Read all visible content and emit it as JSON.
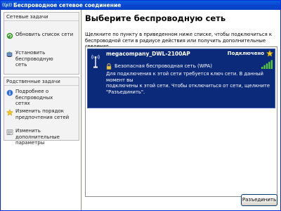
{
  "window": {
    "title": "Беспроводное сетевое соединение",
    "icon_text": "((p))"
  },
  "left_pane": {
    "network_tasks": {
      "title": "Сетевые задачи",
      "items": [
        {
          "label": "Обновить список сети",
          "icon": "refresh-icon"
        },
        {
          "label": "Установить беспроводную\nсеть",
          "icon": "setup-network-icon"
        }
      ]
    },
    "related_tasks": {
      "title": "Родственные задачи",
      "items": [
        {
          "label": "Подробнее о беспроводных\nсетях",
          "icon": "info-icon"
        },
        {
          "label": "Изменить порядок\nпредпочтения сетей",
          "icon": "star-order-icon"
        },
        {
          "label": "Изменить дополнительные\nпараметры",
          "icon": "settings-icon"
        }
      ]
    }
  },
  "main": {
    "title": "Выберите беспроводную сеть",
    "description": "Щелкните по пункту в приведенном ниже списке, чтобы подключиться к\nбеспроводной сети в радиусе действия или получить дополнительные сведения.",
    "networks": [
      {
        "ssid": "megacompany_DWL-2100AP",
        "status": "Подключено",
        "security": "Безопасная беспроводная сеть (WPA)",
        "info": "Для подключения к этой сети требуется ключ сети. В данный момент вы\nподключены к этой сети. Чтобы отключиться от сети, щелкните\n\"Разъединить\".",
        "signal_bars": 5,
        "signal_max": 5
      }
    ],
    "disconnect_label": "Разъединить"
  },
  "colors": {
    "titlebar": "#0a48d0",
    "selected_item": "#0c2a7a",
    "signal": "#58c93a",
    "star": "#f2c618"
  }
}
